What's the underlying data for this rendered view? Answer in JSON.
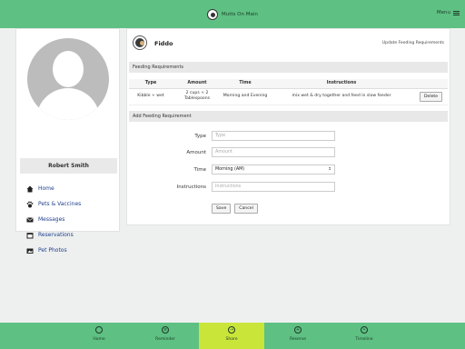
{
  "header": {
    "brand_name": "Mutts On Main",
    "menu_label": "Menu"
  },
  "sidebar": {
    "user_name": "Robert Smith",
    "items": [
      {
        "label": "Home",
        "icon": "home-icon"
      },
      {
        "label": "Pets & Vaccines",
        "icon": "paw-icon"
      },
      {
        "label": "Messages",
        "icon": "envelope-icon"
      },
      {
        "label": "Reservations",
        "icon": "calendar-icon"
      },
      {
        "label": "Pet Photos",
        "icon": "photo-icon"
      }
    ]
  },
  "main": {
    "pet_name": "Fiddo",
    "update_link": "Update Feeding Requirements",
    "feeding_section_title": "Feeding Requirements",
    "table": {
      "headers": [
        "Type",
        "Amount",
        "Time",
        "Instructions",
        ""
      ],
      "rows": [
        {
          "type": "Kibble + wet",
          "amount": "2 cups + 2 Tablespoons",
          "time": "Morning and Evening",
          "instructions": "mix wet & dry together and feed in slow feeder",
          "action": "Delete"
        }
      ]
    },
    "add_section_title": "Add Feeding Requirement",
    "form": {
      "type_label": "Type",
      "type_placeholder": "Type",
      "amount_label": "Amount",
      "amount_placeholder": "Amount",
      "time_label": "Time",
      "time_value": "Morning (AM)",
      "instructions_label": "Instructions",
      "instructions_placeholder": "Instructions",
      "save_label": "Save",
      "cancel_label": "Cancel"
    }
  },
  "bottom_nav": {
    "tabs": [
      {
        "label": "Home",
        "icon": "home-circle-icon",
        "active": false
      },
      {
        "label": "Reminder",
        "icon": "reminder-icon",
        "active": false
      },
      {
        "label": "Share",
        "icon": "share-icon",
        "active": true
      },
      {
        "label": "Reserve",
        "icon": "plus-circle-icon",
        "active": false
      },
      {
        "label": "Timeline",
        "icon": "timeline-icon",
        "active": false
      }
    ]
  },
  "colors": {
    "brand_green": "#5ec083",
    "active_tab": "#c9e53a",
    "link_blue": "#1e3f8c"
  }
}
